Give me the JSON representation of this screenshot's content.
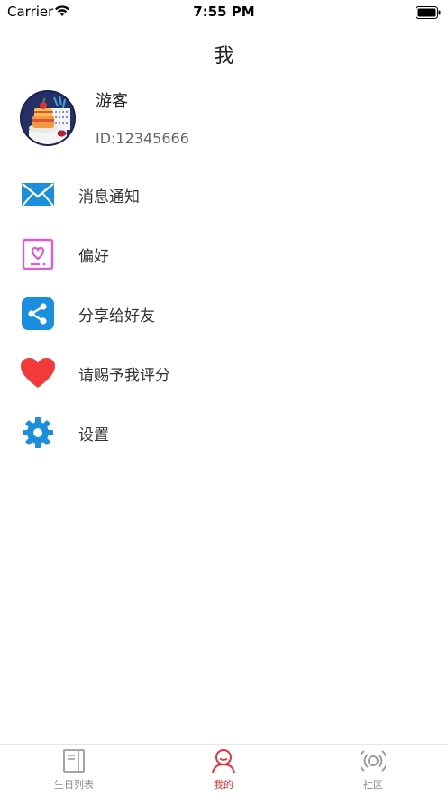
{
  "status_bar": {
    "carrier": "Carrier",
    "time": "7:55 PM"
  },
  "nav": {
    "title": "我"
  },
  "profile": {
    "name": "游客",
    "id": "ID:12345666"
  },
  "menu": {
    "items": [
      {
        "label": "消息通知",
        "icon": "envelope-icon",
        "color": "#1a8fe0"
      },
      {
        "label": "偏好",
        "icon": "heart-card-icon",
        "color": "#e05ad6"
      },
      {
        "label": "分享给好友",
        "icon": "share-icon",
        "color": "#1a8fe0"
      },
      {
        "label": "请赐予我评分",
        "icon": "heart-icon",
        "color": "#f23a3a"
      },
      {
        "label": "设置",
        "icon": "gear-icon",
        "color": "#1a8fe0"
      }
    ]
  },
  "tabbar": {
    "tabs": [
      {
        "label": "生日列表",
        "icon": "book-icon",
        "active": false
      },
      {
        "label": "我的",
        "icon": "person-icon",
        "active": true
      },
      {
        "label": "社区",
        "icon": "broadcast-icon",
        "active": false
      }
    ]
  },
  "colors": {
    "accent": "#e8323a",
    "icon_blue": "#1a8fe0"
  }
}
